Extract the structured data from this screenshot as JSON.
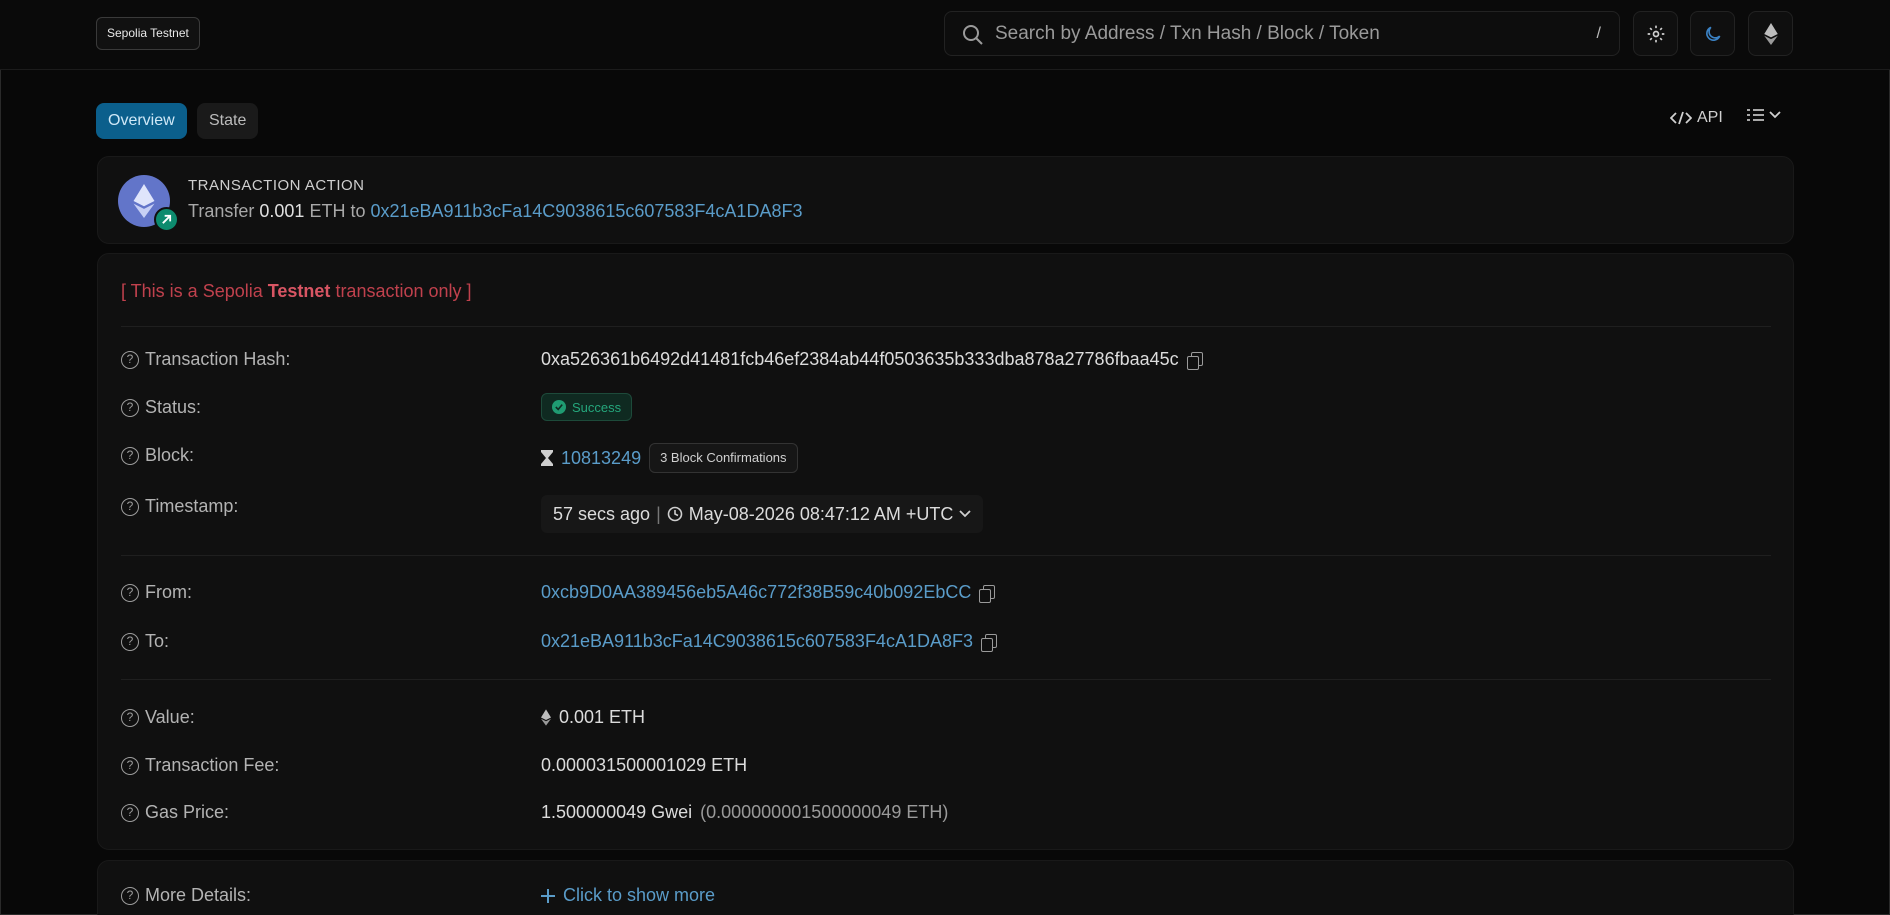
{
  "header": {
    "network_badge": "Sepolia Testnet",
    "search": {
      "placeholder": "Search by Address / Txn Hash / Block / Token",
      "shortcut": "/"
    }
  },
  "tabs": [
    {
      "label": "Overview",
      "active": true
    },
    {
      "label": "State",
      "active": false
    }
  ],
  "toolbar": {
    "api_label": "API"
  },
  "action": {
    "title": "TRANSACTION ACTION",
    "verb": "Transfer",
    "amount": "0.001",
    "unit": "ETH",
    "to_word": "to",
    "to_address": "0x21eBA911b3cFa14C9038615c607583F4cA1DA8F3"
  },
  "notice": {
    "prefix": "[ This is a Sepolia ",
    "bold": "Testnet",
    "suffix": " transaction only ]"
  },
  "details": {
    "tx_hash": {
      "label": "Transaction Hash:",
      "value": "0xa526361b6492d41481fcb46ef2384ab44f0503635b333dba878a27786fbaa45c"
    },
    "status": {
      "label": "Status:",
      "value": "Success"
    },
    "block": {
      "label": "Block:",
      "value": "10813249",
      "confirmations": "3 Block Confirmations"
    },
    "timestamp": {
      "label": "Timestamp:",
      "relative": "57 secs ago",
      "separator": "|",
      "absolute": "May-08-2026 08:47:12 AM +UTC"
    },
    "from": {
      "label": "From:",
      "value": "0xcb9D0AA389456eb5A46c772f38B59c40b092EbCC"
    },
    "to": {
      "label": "To:",
      "value": "0x21eBA911b3cFa14C9038615c607583F4cA1DA8F3"
    },
    "value": {
      "label": "Value:",
      "value": "0.001 ETH"
    },
    "fee": {
      "label": "Transaction Fee:",
      "value": "0.000031500001029 ETH"
    },
    "gas_price": {
      "label": "Gas Price:",
      "value": "1.500000049 Gwei",
      "eth_equiv": "(0.000000001500000049 ETH)"
    },
    "more": {
      "label": "More Details:",
      "link": "Click to show more"
    }
  },
  "colors": {
    "accent": "#0b5f8c",
    "link": "#5a9cc9",
    "success": "#25a67c",
    "testnet_red": "#c0414d"
  },
  "icons": [
    "search-icon",
    "gear-icon",
    "moon-icon",
    "ethereum-icon",
    "code-icon",
    "list-filter-icon",
    "chevron-down-icon",
    "question-icon",
    "copy-icon",
    "hourglass-icon",
    "clock-icon",
    "check-circle-icon",
    "arrow-up-right-icon",
    "plus-icon"
  ]
}
